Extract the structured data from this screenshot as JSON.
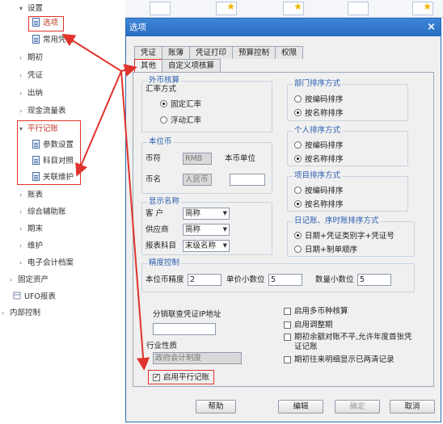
{
  "tree": {
    "items": [
      {
        "label": "设置"
      },
      {
        "label": "选项"
      },
      {
        "label": "常用凭证"
      },
      {
        "label": "期初"
      },
      {
        "label": "凭证"
      },
      {
        "label": "出纳"
      },
      {
        "label": "现金流量表"
      },
      {
        "label": "平行记账"
      },
      {
        "label": "参数设置"
      },
      {
        "label": "科目对照"
      },
      {
        "label": "关联维护"
      },
      {
        "label": "账表"
      },
      {
        "label": "综合辅助账"
      },
      {
        "label": "期末"
      },
      {
        "label": "维护"
      },
      {
        "label": "电子会计档案"
      },
      {
        "label": "固定资产"
      },
      {
        "label": "UFO报表"
      },
      {
        "label": "内部控制"
      }
    ]
  },
  "dialog": {
    "title": "选项",
    "close": "×",
    "tabs_row1": [
      "凭证",
      "账簿",
      "凭证打印",
      "预算控制",
      "权限"
    ],
    "tabs_row2": [
      "其他",
      "自定义项核算"
    ],
    "foreign": {
      "title": "外币核算",
      "rate_label": "汇率方式",
      "opt1": "固定汇率",
      "opt2": "浮动汇率"
    },
    "base": {
      "title": "本位币",
      "code_label": "币符",
      "code_value": "RMB",
      "unit_label": "本币单位",
      "unit_value": "",
      "name_label": "币名",
      "name_value": "人民币"
    },
    "display": {
      "title": "显示名称",
      "customer_label": "客 户",
      "customer_value": "简称",
      "supplier_label": "供应商",
      "supplier_value": "简称",
      "subject_label": "报表科目",
      "subject_value": "末级名称"
    },
    "dept": {
      "title": "部门排序方式",
      "opt1": "按编码排序",
      "opt2": "按名称排序"
    },
    "person": {
      "title": "个人排序方式",
      "opt1": "按编码排序",
      "opt2": "按名称排序"
    },
    "project": {
      "title": "项目排序方式",
      "opt1": "按编码排序",
      "opt2": "按名称排序"
    },
    "journal": {
      "title": "日记账、序时账排序方式",
      "opt1": "日期+凭证类别字+凭证号",
      "opt2": "日期+制单顺序"
    },
    "precision": {
      "title": "精度控制",
      "base_label": "本位币精度",
      "base_value": "2",
      "price_label": "单价小数位",
      "price_value": "5",
      "qty_label": "数量小数位",
      "qty_value": "5"
    },
    "dist_label": "分销联查凭证IP地址",
    "dist_value": "",
    "industry_label": "行业性质",
    "industry_value": "政府会计制度",
    "checks": {
      "multi_currency": "启用多币种核算",
      "adjust_period": "启用调整期",
      "opening_balance": "期初余额对账不平,允许年度首张凭证记账",
      "opening_detail": "期初往来明细显示已两清记录",
      "parallel": "启用平行记账"
    },
    "buttons": {
      "help": "帮助",
      "edit": "编辑",
      "ok": "确定",
      "cancel": "取消"
    }
  },
  "colors": {
    "accent": "#2a6cc0",
    "annotation": "#e0332b",
    "group_title": "#2a5db0"
  }
}
